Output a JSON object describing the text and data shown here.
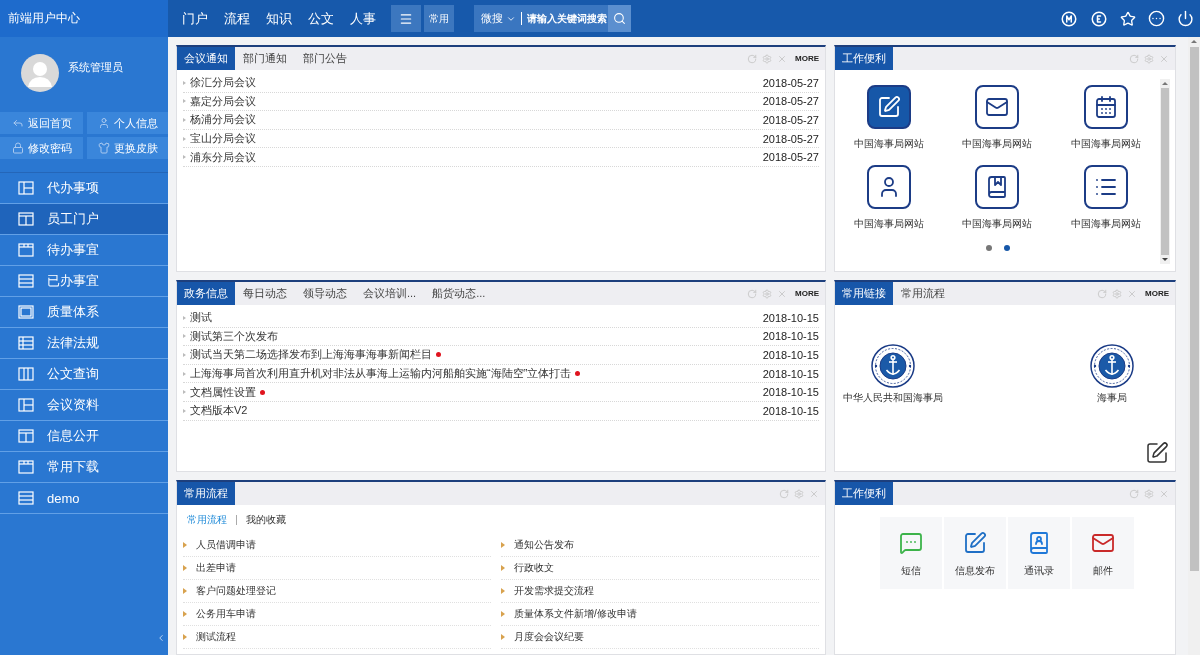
{
  "header": {
    "logo": "前端用户中心",
    "nav": [
      "门户",
      "流程",
      "知识",
      "公文",
      "人事"
    ],
    "quick_link": "常用",
    "search": {
      "scope": "微搜",
      "placeholder": "请输入关键词搜索"
    }
  },
  "user": {
    "name": "系统管理员",
    "actions": [
      {
        "label": "返回首页",
        "kind": "home"
      },
      {
        "label": "个人信息",
        "kind": "profile"
      },
      {
        "label": "修改密码",
        "kind": "password"
      },
      {
        "label": "更换皮肤",
        "kind": "skin"
      }
    ]
  },
  "sidebar": {
    "items": [
      {
        "label": "代办事项",
        "selected": false
      },
      {
        "label": "员工门户",
        "selected": true
      },
      {
        "label": "待办事宜",
        "selected": false
      },
      {
        "label": "已办事宜",
        "selected": false
      },
      {
        "label": "质量体系",
        "selected": false
      },
      {
        "label": "法律法规",
        "selected": false
      },
      {
        "label": "公文查询",
        "selected": false
      },
      {
        "label": "会议资料",
        "selected": false
      },
      {
        "label": "信息公开",
        "selected": false
      },
      {
        "label": "常用下载",
        "selected": false
      },
      {
        "label": "demo",
        "selected": false
      }
    ]
  },
  "notice_panel": {
    "tabs": [
      {
        "label": "会议通知",
        "selected": true
      },
      {
        "label": "部门通知",
        "selected": false
      },
      {
        "label": "部门公告",
        "selected": false
      }
    ],
    "more": "MORE",
    "rows": [
      {
        "title": "徐汇分局会议",
        "date": "2018-05-27",
        "new": false
      },
      {
        "title": "嘉定分局会议",
        "date": "2018-05-27",
        "new": false
      },
      {
        "title": "杨浦分局会议",
        "date": "2018-05-27",
        "new": false
      },
      {
        "title": "宝山分局会议",
        "date": "2018-05-27",
        "new": false
      },
      {
        "title": "浦东分局会议",
        "date": "2018-05-27",
        "new": false
      }
    ]
  },
  "tools_panel": {
    "tabs": [
      {
        "label": "工作便利",
        "selected": true
      }
    ],
    "shortcuts": [
      {
        "label": "中国海事局网站",
        "kind": "edit",
        "highlighted": true
      },
      {
        "label": "中国海事局网站",
        "kind": "mail",
        "highlighted": false
      },
      {
        "label": "中国海事局网站",
        "kind": "calendar",
        "highlighted": false
      },
      {
        "label": "中国海事局网站",
        "kind": "user",
        "highlighted": false
      },
      {
        "label": "中国海事局网站",
        "kind": "book",
        "highlighted": false
      },
      {
        "label": "中国海事局网站",
        "kind": "list",
        "highlighted": false
      }
    ],
    "pages": [
      {
        "selected": false
      },
      {
        "selected": true
      }
    ]
  },
  "affairs_panel": {
    "tabs": [
      {
        "label": "政务信息",
        "selected": true
      },
      {
        "label": "每日动态",
        "selected": false
      },
      {
        "label": "领导动态",
        "selected": false
      },
      {
        "label": "会议培训...",
        "selected": false
      },
      {
        "label": "船货动态...",
        "selected": false
      }
    ],
    "more": "MORE",
    "rows": [
      {
        "title": "测试",
        "date": "2018-10-15",
        "new": false
      },
      {
        "title": "测试第三个次发布",
        "date": "2018-10-15",
        "new": false
      },
      {
        "title": "测试当天第二场选择发布到上海海事海事新闻栏目",
        "date": "2018-10-15",
        "new": true
      },
      {
        "title": "上海海事局首次利用直升机对非法从事海上运输内河船舶实施“海陆空”立体打击",
        "date": "2018-10-15",
        "new": true
      },
      {
        "title": "文档属性设置",
        "date": "2018-10-15",
        "new": true
      },
      {
        "title": "文档版本V2",
        "date": "2018-10-15",
        "new": false
      }
    ]
  },
  "links_panel": {
    "tabs": [
      {
        "label": "常用链接",
        "selected": true
      },
      {
        "label": "常用流程",
        "selected": false
      }
    ],
    "more": "MORE",
    "links": [
      "中华人民共和国海事局",
      "海事局"
    ]
  },
  "process_panel": {
    "tabs": [
      {
        "label": "常用流程",
        "selected": true
      }
    ],
    "subtabs": [
      {
        "label": "常用流程",
        "selected": true
      },
      {
        "label": "我的收藏",
        "selected": false
      }
    ],
    "items": [
      "人员借调申请",
      "通知公告发布",
      "出差申请",
      "行政收文",
      "客户问题处理登记",
      "开发需求提交流程",
      "公务用车申请",
      "质量体系文件新增/修改申请",
      "测试流程",
      "月度会会议纪要"
    ]
  },
  "apps_panel": {
    "tabs": [
      {
        "label": "工作便利",
        "selected": true
      }
    ],
    "apps": [
      {
        "label": "短信",
        "kind": "chat"
      },
      {
        "label": "信息发布",
        "kind": "edit"
      },
      {
        "label": "通讯录",
        "kind": "contacts"
      },
      {
        "label": "邮件",
        "kind": "mail"
      }
    ]
  }
}
